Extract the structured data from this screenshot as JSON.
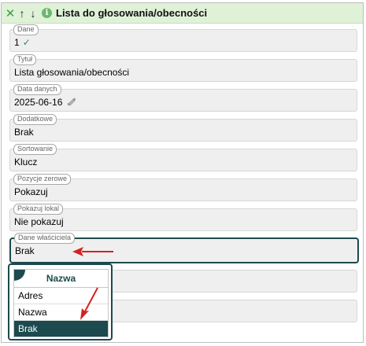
{
  "header": {
    "title": "Lista do głosowania/obecności",
    "close_icon": "close-x-icon",
    "up_icon": "arrow-up-icon",
    "down_icon": "arrow-down-icon",
    "info_icon": "info-icon",
    "color": "#dff2d8"
  },
  "fields": [
    {
      "label": "Dane",
      "value": "1"
    },
    {
      "label": "Tytuł",
      "value": "Lista głosowania/obecności"
    },
    {
      "label": "Data danych",
      "value": "2025-06-16"
    },
    {
      "label": "Dodatkowe",
      "value": "Brak"
    },
    {
      "label": "Sortowanie",
      "value": "Klucz"
    },
    {
      "label": "Pozycje zerowe",
      "value": "Pokazuj"
    },
    {
      "label": "Pokazuj lokal",
      "value": "Nie pokazuj"
    },
    {
      "label": "Dane właściciela",
      "value": "Brak"
    }
  ],
  "dropdown": {
    "header": "Nazwa",
    "options": [
      "Adres",
      "Nazwa",
      "Brak"
    ],
    "selected": "Brak"
  },
  "colors": {
    "accent": "#1c4a4e",
    "field_bg": "#efefef",
    "annotation_arrow": "#d62020"
  }
}
